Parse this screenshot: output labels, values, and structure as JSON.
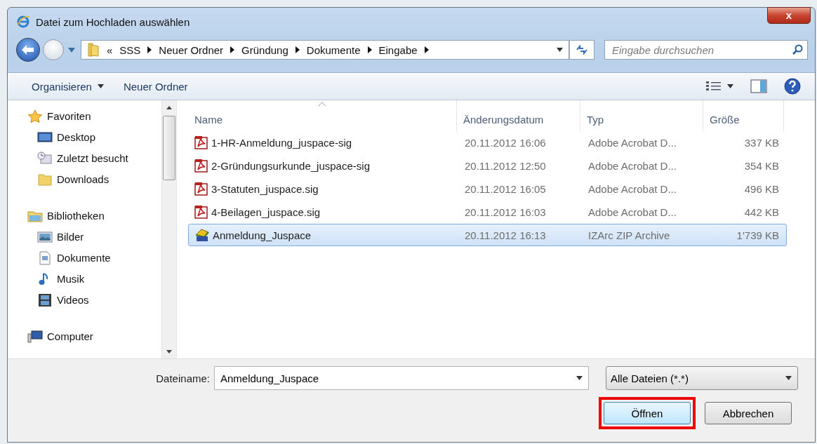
{
  "window": {
    "title": "Datei zum Hochladen auswählen",
    "close": "x"
  },
  "address": {
    "overflow": "«",
    "crumbs": [
      "SSS",
      "Neuer Ordner",
      "Gründung",
      "Dokumente",
      "Eingabe"
    ]
  },
  "search": {
    "placeholder": "Eingabe durchsuchen"
  },
  "toolbar": {
    "organize": "Organisieren",
    "new_folder": "Neuer Ordner"
  },
  "sidebar": {
    "groups": [
      {
        "label": "Favoriten",
        "kind": "star",
        "items": [
          {
            "label": "Desktop",
            "kind": "desktop"
          },
          {
            "label": "Zuletzt besucht",
            "kind": "recent"
          },
          {
            "label": "Downloads",
            "kind": "folder"
          }
        ]
      },
      {
        "label": "Bibliotheken",
        "kind": "library",
        "items": [
          {
            "label": "Bilder",
            "kind": "pictures"
          },
          {
            "label": "Dokumente",
            "kind": "documents"
          },
          {
            "label": "Musik",
            "kind": "music"
          },
          {
            "label": "Videos",
            "kind": "videos"
          }
        ]
      },
      {
        "label": "Computer",
        "kind": "computer"
      }
    ]
  },
  "table": {
    "columns": [
      {
        "label": "Name",
        "sorted": true
      },
      {
        "label": "Änderungsdatum",
        "sorted": false
      },
      {
        "label": "Typ",
        "sorted": false
      },
      {
        "label": "Größe",
        "sorted": false
      }
    ],
    "rows": [
      {
        "name": "1-HR-Anmeldung_juspace-sig",
        "date": "20.11.2012 16:06",
        "type": "Adobe Acrobat D...",
        "size": "337 KB",
        "kind": "pdf",
        "selected": false
      },
      {
        "name": "2-Gründungsurkunde_juspace-sig",
        "date": "20.11.2012 12:50",
        "type": "Adobe Acrobat D...",
        "size": "354 KB",
        "kind": "pdf",
        "selected": false
      },
      {
        "name": "3-Statuten_juspace.sig",
        "date": "20.11.2012 16:05",
        "type": "Adobe Acrobat D...",
        "size": "496 KB",
        "kind": "pdf",
        "selected": false
      },
      {
        "name": "4-Beilagen_juspace.sig",
        "date": "20.11.2012 16:03",
        "type": "Adobe Acrobat D...",
        "size": "442 KB",
        "kind": "pdf",
        "selected": false
      },
      {
        "name": "Anmeldung_Juspace",
        "date": "20.11.2012 16:13",
        "type": "IZArc ZIP Archive",
        "size": "1'739 KB",
        "kind": "zip",
        "selected": true
      }
    ]
  },
  "footer": {
    "filename_label": "Dateiname:",
    "filename": "Anmeldung_Juspace",
    "filter": "Alle Dateien (*.*)",
    "buttons": [
      {
        "label": "Öffnen",
        "highlighted": true
      },
      {
        "label": "Abbrechen",
        "highlighted": false
      }
    ]
  }
}
